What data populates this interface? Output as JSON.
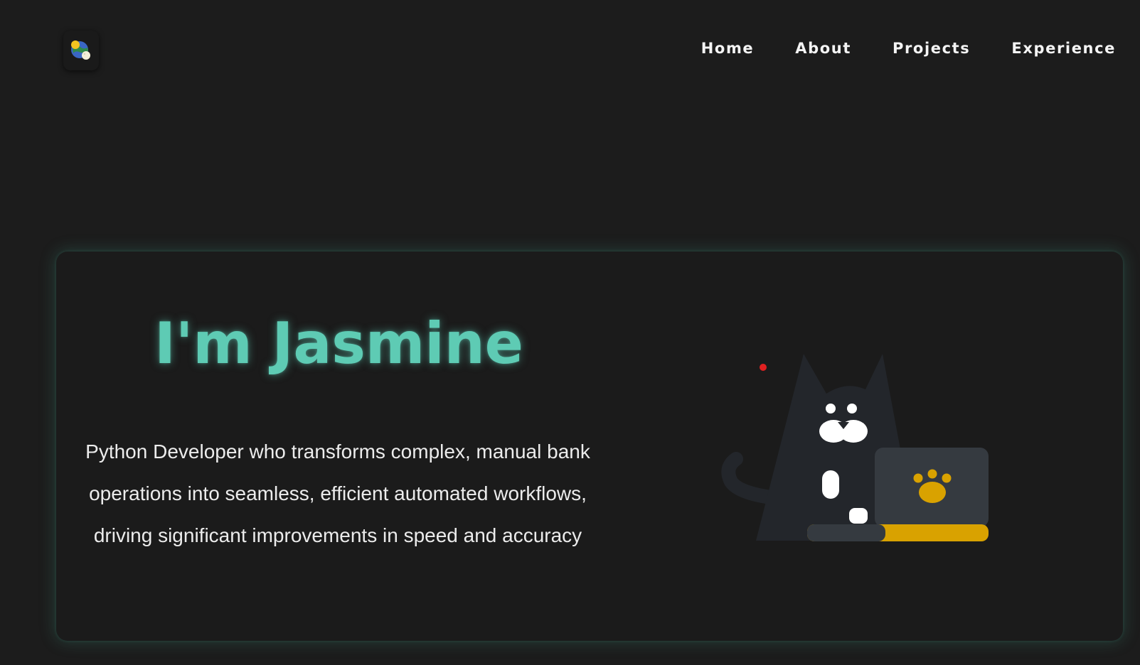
{
  "nav": {
    "items": [
      {
        "label": "Home"
      },
      {
        "label": "About"
      },
      {
        "label": "Projects"
      },
      {
        "label": "Experience"
      }
    ]
  },
  "logo": {
    "icon": "globe-sun-moon-icon"
  },
  "hero": {
    "title": "I'm Jasmine",
    "description": "Python Developer who transforms complex, manual bank operations into seamless, efficient automated workflows, driving significant improvements in speed and accuracy"
  },
  "illustration": {
    "icon": "cat-with-laptop-icon"
  },
  "colors": {
    "background": "#1c1c1c",
    "accent": "#5ecbb4",
    "laptop_base": "#d9a200",
    "cat_body": "#23262b",
    "laser_dot": "#e02020"
  }
}
